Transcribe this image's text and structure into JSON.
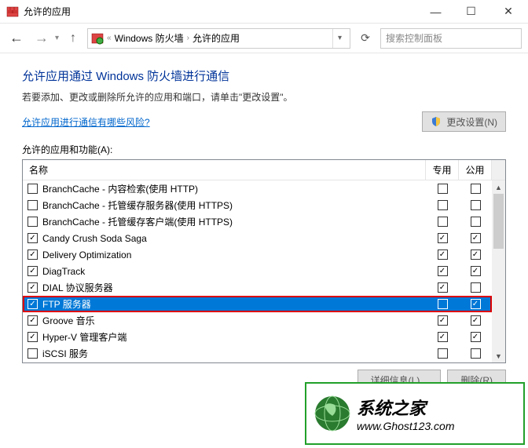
{
  "window": {
    "title": "允许的应用",
    "min": "—",
    "max": "☐",
    "close": "✕"
  },
  "nav": {
    "breadcrumb1": "Windows 防火墙",
    "breadcrumb2": "允许的应用",
    "search_placeholder": "搜索控制面板"
  },
  "page": {
    "heading": "允许应用通过 Windows 防火墙进行通信",
    "subheading": "若要添加、更改或删除所允许的应用和端口，请单击\"更改设置\"。",
    "risk_link": "允许应用进行通信有哪些风险?",
    "change_settings": "更改设置(N)",
    "list_label": "允许的应用和功能(A):",
    "col_name": "名称",
    "col_private": "专用",
    "col_public": "公用",
    "details_btn": "详细信息(L)...",
    "remove_btn": "删除(R)"
  },
  "apps": [
    {
      "checked": false,
      "name": "BranchCache - 内容检索(使用 HTTP)",
      "priv": false,
      "pub": false,
      "sel": false,
      "hl": false
    },
    {
      "checked": false,
      "name": "BranchCache - 托管缓存服务器(使用 HTTPS)",
      "priv": false,
      "pub": false,
      "sel": false,
      "hl": false
    },
    {
      "checked": false,
      "name": "BranchCache - 托管缓存客户端(使用 HTTPS)",
      "priv": false,
      "pub": false,
      "sel": false,
      "hl": false
    },
    {
      "checked": true,
      "name": "Candy Crush Soda Saga",
      "priv": true,
      "pub": true,
      "sel": false,
      "hl": false
    },
    {
      "checked": true,
      "name": "Delivery Optimization",
      "priv": true,
      "pub": true,
      "sel": false,
      "hl": false
    },
    {
      "checked": true,
      "name": "DiagTrack",
      "priv": true,
      "pub": true,
      "sel": false,
      "hl": false
    },
    {
      "checked": true,
      "name": "DIAL 协议服务器",
      "priv": true,
      "pub": false,
      "sel": false,
      "hl": false
    },
    {
      "checked": true,
      "name": "FTP 服务器",
      "priv": false,
      "pub": true,
      "sel": true,
      "hl": true
    },
    {
      "checked": true,
      "name": "Groove 音乐",
      "priv": true,
      "pub": true,
      "sel": false,
      "hl": false
    },
    {
      "checked": true,
      "name": "Hyper-V 管理客户端",
      "priv": true,
      "pub": true,
      "sel": false,
      "hl": false
    },
    {
      "checked": false,
      "name": "iSCSI 服务",
      "priv": false,
      "pub": false,
      "sel": false,
      "hl": false
    }
  ],
  "watermark": {
    "cn": "系统之家",
    "url": "www.Ghost123.com"
  }
}
